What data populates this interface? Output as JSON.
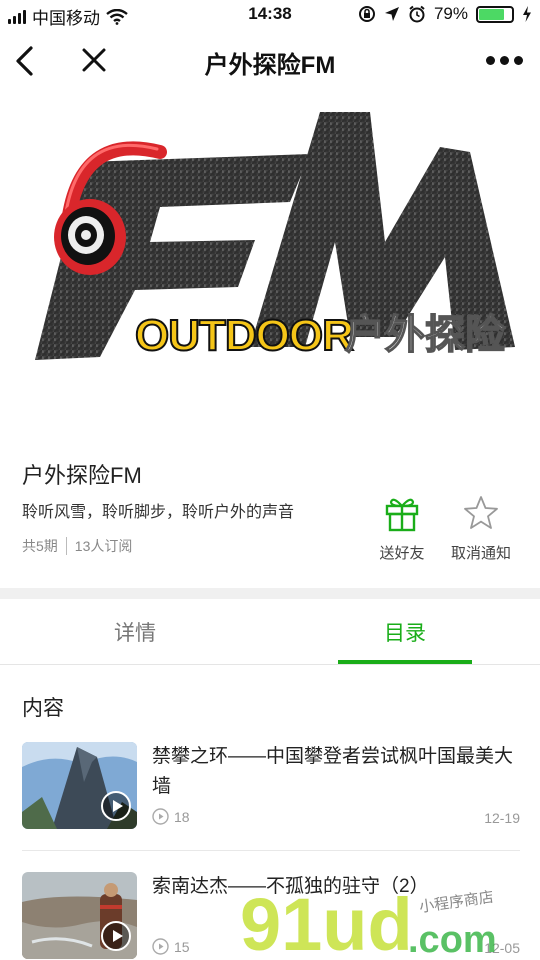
{
  "status_bar": {
    "carrier": "中国移动",
    "time": "14:38",
    "battery": "79%",
    "battery_level": 0.79
  },
  "nav": {
    "title": "户外探险FM",
    "icons": [
      "back-icon",
      "close-icon",
      "more-icon"
    ]
  },
  "cover": {
    "logo_fm": "FM",
    "logo_outdoor": "OUTDOOR",
    "logo_cn": "户外探险"
  },
  "program": {
    "name": "户外探险FM",
    "description": "聆听风雪，聆听脚步，聆听户外的声音",
    "episodes_count": "共5期",
    "subscribers": "13人订阅"
  },
  "actions": {
    "gift_label": "送好友",
    "unsubscribe_label": "取消通知"
  },
  "tabs": {
    "details": "详情",
    "catalog": "目录",
    "active": "catalog"
  },
  "section_title": "内容",
  "episodes": [
    {
      "title": "禁攀之环——中国攀登者尝试枫叶国最美大墙",
      "plays": "18",
      "date": "12-19"
    },
    {
      "title": "索南达杰——不孤独的驻守（2）",
      "plays": "15",
      "date": "12-05"
    }
  ],
  "watermark": {
    "brand": "91ud",
    "suffix": ".com",
    "tagline": "小程序商店"
  },
  "colors": {
    "accent_green": "#1aad19",
    "logo_red": "#d9262b",
    "logo_yellow": "#f5c518"
  }
}
